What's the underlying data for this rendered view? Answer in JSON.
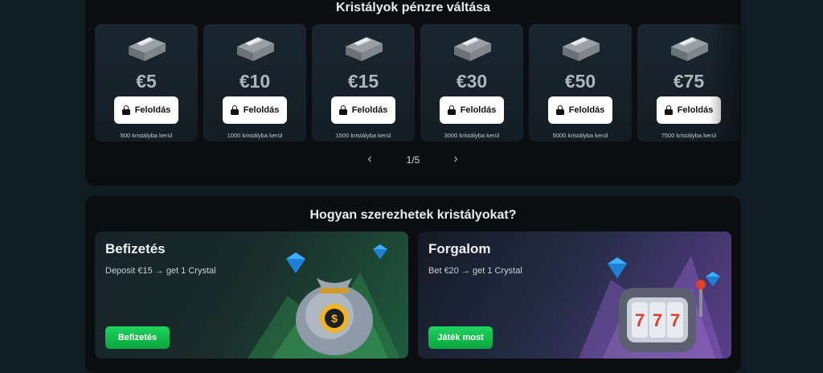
{
  "exchange": {
    "title": "Kristályok pénzre váltása",
    "cards": [
      {
        "amount": "€5",
        "button": "Feloldás",
        "note": "500 kristályba kerül"
      },
      {
        "amount": "€10",
        "button": "Feloldás",
        "note": "1000 kristályba kerül"
      },
      {
        "amount": "€15",
        "button": "Feloldás",
        "note": "1500 kristályba kerül"
      },
      {
        "amount": "€30",
        "button": "Feloldás",
        "note": "3000 kristályba kerül"
      },
      {
        "amount": "€50",
        "button": "Feloldás",
        "note": "5000 kristályba kerül"
      },
      {
        "amount": "€75",
        "button": "Feloldás",
        "note": "7500 kristályba kerül"
      }
    ],
    "pager": {
      "label": "1/5",
      "prev_icon": "chevron-left-icon",
      "next_icon": "chevron-right-icon"
    }
  },
  "how": {
    "title": "Hogyan szerezhetek kristályokat?",
    "deposit": {
      "title": "Befizetés",
      "description": "Deposit €15 → get 1 Crystal",
      "button": "Befizetés"
    },
    "turnover": {
      "title": "Forgalom",
      "description": "Bet €20 → get 1 Crystal",
      "button": "Játék most"
    }
  },
  "colors": {
    "accent_green": "#14c450",
    "panel": "#0b0d10",
    "card": "#1a2630",
    "background": "#0f1c22"
  }
}
